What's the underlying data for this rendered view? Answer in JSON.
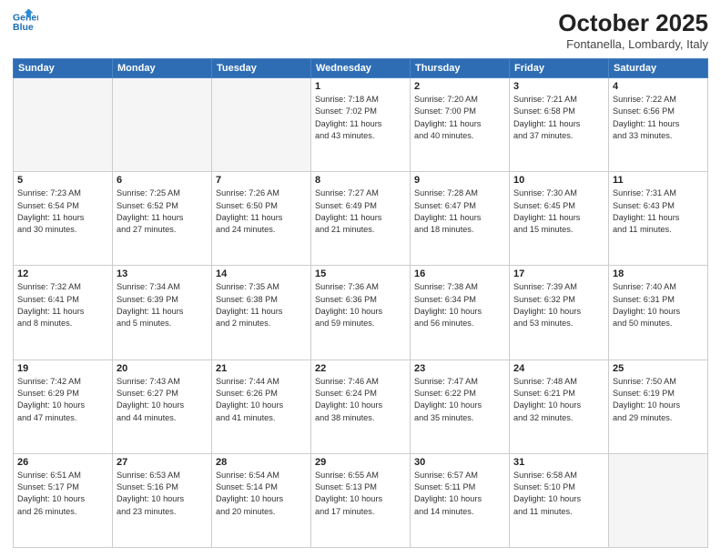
{
  "header": {
    "logo_line1": "General",
    "logo_line2": "Blue",
    "month": "October 2025",
    "location": "Fontanella, Lombardy, Italy"
  },
  "weekdays": [
    "Sunday",
    "Monday",
    "Tuesday",
    "Wednesday",
    "Thursday",
    "Friday",
    "Saturday"
  ],
  "weeks": [
    [
      {
        "day": "",
        "info": ""
      },
      {
        "day": "",
        "info": ""
      },
      {
        "day": "",
        "info": ""
      },
      {
        "day": "1",
        "info": "Sunrise: 7:18 AM\nSunset: 7:02 PM\nDaylight: 11 hours\nand 43 minutes."
      },
      {
        "day": "2",
        "info": "Sunrise: 7:20 AM\nSunset: 7:00 PM\nDaylight: 11 hours\nand 40 minutes."
      },
      {
        "day": "3",
        "info": "Sunrise: 7:21 AM\nSunset: 6:58 PM\nDaylight: 11 hours\nand 37 minutes."
      },
      {
        "day": "4",
        "info": "Sunrise: 7:22 AM\nSunset: 6:56 PM\nDaylight: 11 hours\nand 33 minutes."
      }
    ],
    [
      {
        "day": "5",
        "info": "Sunrise: 7:23 AM\nSunset: 6:54 PM\nDaylight: 11 hours\nand 30 minutes."
      },
      {
        "day": "6",
        "info": "Sunrise: 7:25 AM\nSunset: 6:52 PM\nDaylight: 11 hours\nand 27 minutes."
      },
      {
        "day": "7",
        "info": "Sunrise: 7:26 AM\nSunset: 6:50 PM\nDaylight: 11 hours\nand 24 minutes."
      },
      {
        "day": "8",
        "info": "Sunrise: 7:27 AM\nSunset: 6:49 PM\nDaylight: 11 hours\nand 21 minutes."
      },
      {
        "day": "9",
        "info": "Sunrise: 7:28 AM\nSunset: 6:47 PM\nDaylight: 11 hours\nand 18 minutes."
      },
      {
        "day": "10",
        "info": "Sunrise: 7:30 AM\nSunset: 6:45 PM\nDaylight: 11 hours\nand 15 minutes."
      },
      {
        "day": "11",
        "info": "Sunrise: 7:31 AM\nSunset: 6:43 PM\nDaylight: 11 hours\nand 11 minutes."
      }
    ],
    [
      {
        "day": "12",
        "info": "Sunrise: 7:32 AM\nSunset: 6:41 PM\nDaylight: 11 hours\nand 8 minutes."
      },
      {
        "day": "13",
        "info": "Sunrise: 7:34 AM\nSunset: 6:39 PM\nDaylight: 11 hours\nand 5 minutes."
      },
      {
        "day": "14",
        "info": "Sunrise: 7:35 AM\nSunset: 6:38 PM\nDaylight: 11 hours\nand 2 minutes."
      },
      {
        "day": "15",
        "info": "Sunrise: 7:36 AM\nSunset: 6:36 PM\nDaylight: 10 hours\nand 59 minutes."
      },
      {
        "day": "16",
        "info": "Sunrise: 7:38 AM\nSunset: 6:34 PM\nDaylight: 10 hours\nand 56 minutes."
      },
      {
        "day": "17",
        "info": "Sunrise: 7:39 AM\nSunset: 6:32 PM\nDaylight: 10 hours\nand 53 minutes."
      },
      {
        "day": "18",
        "info": "Sunrise: 7:40 AM\nSunset: 6:31 PM\nDaylight: 10 hours\nand 50 minutes."
      }
    ],
    [
      {
        "day": "19",
        "info": "Sunrise: 7:42 AM\nSunset: 6:29 PM\nDaylight: 10 hours\nand 47 minutes."
      },
      {
        "day": "20",
        "info": "Sunrise: 7:43 AM\nSunset: 6:27 PM\nDaylight: 10 hours\nand 44 minutes."
      },
      {
        "day": "21",
        "info": "Sunrise: 7:44 AM\nSunset: 6:26 PM\nDaylight: 10 hours\nand 41 minutes."
      },
      {
        "day": "22",
        "info": "Sunrise: 7:46 AM\nSunset: 6:24 PM\nDaylight: 10 hours\nand 38 minutes."
      },
      {
        "day": "23",
        "info": "Sunrise: 7:47 AM\nSunset: 6:22 PM\nDaylight: 10 hours\nand 35 minutes."
      },
      {
        "day": "24",
        "info": "Sunrise: 7:48 AM\nSunset: 6:21 PM\nDaylight: 10 hours\nand 32 minutes."
      },
      {
        "day": "25",
        "info": "Sunrise: 7:50 AM\nSunset: 6:19 PM\nDaylight: 10 hours\nand 29 minutes."
      }
    ],
    [
      {
        "day": "26",
        "info": "Sunrise: 6:51 AM\nSunset: 5:17 PM\nDaylight: 10 hours\nand 26 minutes."
      },
      {
        "day": "27",
        "info": "Sunrise: 6:53 AM\nSunset: 5:16 PM\nDaylight: 10 hours\nand 23 minutes."
      },
      {
        "day": "28",
        "info": "Sunrise: 6:54 AM\nSunset: 5:14 PM\nDaylight: 10 hours\nand 20 minutes."
      },
      {
        "day": "29",
        "info": "Sunrise: 6:55 AM\nSunset: 5:13 PM\nDaylight: 10 hours\nand 17 minutes."
      },
      {
        "day": "30",
        "info": "Sunrise: 6:57 AM\nSunset: 5:11 PM\nDaylight: 10 hours\nand 14 minutes."
      },
      {
        "day": "31",
        "info": "Sunrise: 6:58 AM\nSunset: 5:10 PM\nDaylight: 10 hours\nand 11 minutes."
      },
      {
        "day": "",
        "info": ""
      }
    ]
  ]
}
